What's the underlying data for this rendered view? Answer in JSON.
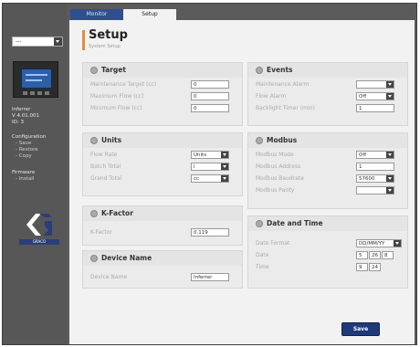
{
  "tabs": {
    "monitor": "Monitor",
    "setup": "Setup"
  },
  "sidebar": {
    "device_select": "---",
    "device_name": "Inferrer",
    "version": "V 4.01.001",
    "id": "ID: 3",
    "configuration_label": "Configuration",
    "config_links": [
      "Save",
      "Restore",
      "Copy"
    ],
    "firmware_label": "Firmware",
    "firmware_links": [
      "Install"
    ],
    "logo_text": "GRACO"
  },
  "header": {
    "title": "Setup",
    "subtitle": "System Setup"
  },
  "target": {
    "title": "Target",
    "fields": [
      {
        "label": "Maintenance Target (cc)",
        "value": "0"
      },
      {
        "label": "Maximum Flow (cc)",
        "value": "0"
      },
      {
        "label": "Minimum Flow (cc)",
        "value": "0"
      }
    ]
  },
  "units": {
    "title": "Units",
    "fields": [
      {
        "label": "Flow Rate",
        "value": "Units"
      },
      {
        "label": "Batch Total",
        "value": "l"
      },
      {
        "label": "Grand Total",
        "value": "cc"
      }
    ]
  },
  "kfactor": {
    "title": "K-Factor",
    "label": "K-Factor",
    "value": "0.119"
  },
  "device_name": {
    "title": "Device Name",
    "label": "Device Name",
    "value": "Inferrer"
  },
  "events": {
    "title": "Events",
    "fields": [
      {
        "label": "Maintenance Alarm",
        "value": ""
      },
      {
        "label": "Flow Alarm",
        "value": "Off"
      },
      {
        "label": "Backlight Timer (min)",
        "value": "1"
      }
    ]
  },
  "modbus": {
    "title": "Modbus",
    "fields": [
      {
        "label": "Modbus Mode",
        "value": "Off"
      },
      {
        "label": "Modbus Address",
        "value": "1"
      },
      {
        "label": "Modbus Baudrate",
        "value": "57600"
      },
      {
        "label": "Modbus Parity",
        "value": ""
      }
    ]
  },
  "datetime": {
    "title": "Date and Time",
    "format_label": "Date Format",
    "format_value": "DD/MM/YY",
    "date_label": "Date",
    "date_parts": [
      "5",
      "26",
      "8"
    ],
    "time_label": "Time",
    "time_parts": [
      "9",
      "24"
    ]
  },
  "save_label": "Save",
  "colors": {
    "accent": "#e08f3b",
    "tab_active": "#2f4f8f",
    "save_button": "#1f3a78"
  }
}
